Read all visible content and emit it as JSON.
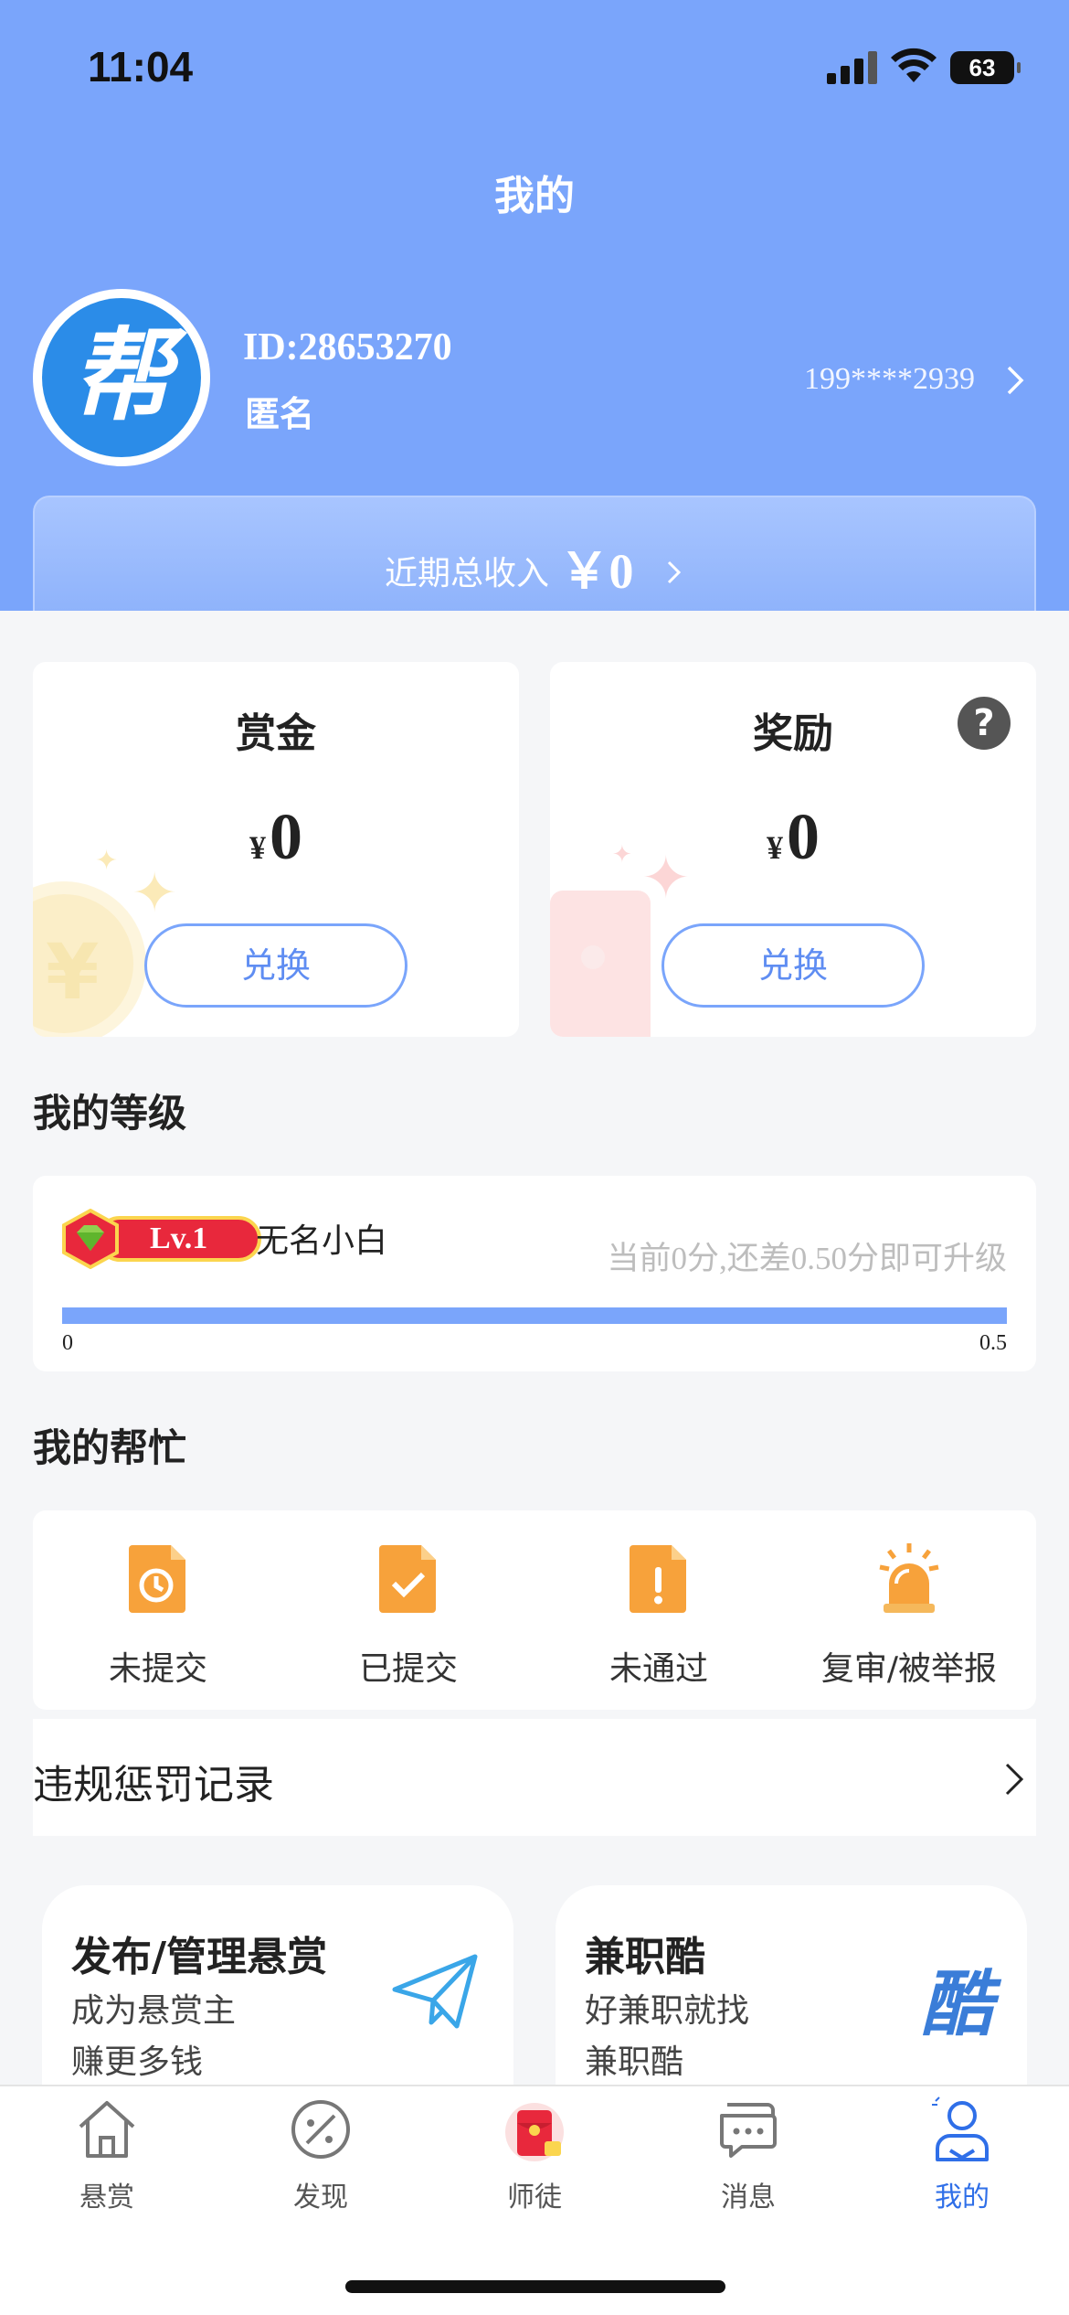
{
  "status_bar": {
    "time": "11:04",
    "battery": "63"
  },
  "header": {
    "title": "我的",
    "avatar_char": "帮",
    "user_id": "ID:28653270",
    "user_name": "匿名",
    "phone": "199****2939",
    "income_label": "近期总收入",
    "income_currency": "￥",
    "income_value": "0"
  },
  "cards": {
    "bounty": {
      "title": "赏金",
      "currency": "¥",
      "amount": "0",
      "button": "兑换"
    },
    "reward": {
      "title": "奖励",
      "currency": "¥",
      "amount": "0",
      "button": "兑换",
      "help": "?"
    }
  },
  "level": {
    "section_title": "我的等级",
    "badge": "Lv.1",
    "name": "无名小白",
    "progress_text": "当前0分,还差0.50分即可升级",
    "min": "0",
    "max": "0.5",
    "progress_fraction": 1.0
  },
  "help": {
    "section_title": "我的帮忙",
    "items": [
      {
        "label": "未提交",
        "icon": "clock-document-icon"
      },
      {
        "label": "已提交",
        "icon": "check-document-icon"
      },
      {
        "label": "未通过",
        "icon": "exclamation-document-icon"
      },
      {
        "label": "复审/被举报",
        "icon": "alarm-siren-icon"
      }
    ]
  },
  "violation": {
    "label": "违规惩罚记录"
  },
  "promos": {
    "publish": {
      "title": "发布/管理悬赏",
      "sub1": "成为悬赏主",
      "sub2": "赚更多钱",
      "icon": "paper-plane-icon"
    },
    "job": {
      "title": "兼职酷",
      "sub1": "好兼职就找",
      "sub2": "兼职酷",
      "logo": "酷"
    }
  },
  "tabs": [
    {
      "label": "悬赏",
      "icon": "home-icon",
      "active": false
    },
    {
      "label": "发现",
      "icon": "palette-icon",
      "active": false
    },
    {
      "label": "师徒",
      "icon": "red-envelope-icon",
      "active": false
    },
    {
      "label": "消息",
      "icon": "chat-icon",
      "active": false
    },
    {
      "label": "我的",
      "icon": "user-icon",
      "active": true
    }
  ],
  "colors": {
    "header_blue": "#7aa5fb",
    "accent_blue": "#2f6fe8",
    "icon_orange": "#f7a23b",
    "badge_red": "#e8283c"
  }
}
